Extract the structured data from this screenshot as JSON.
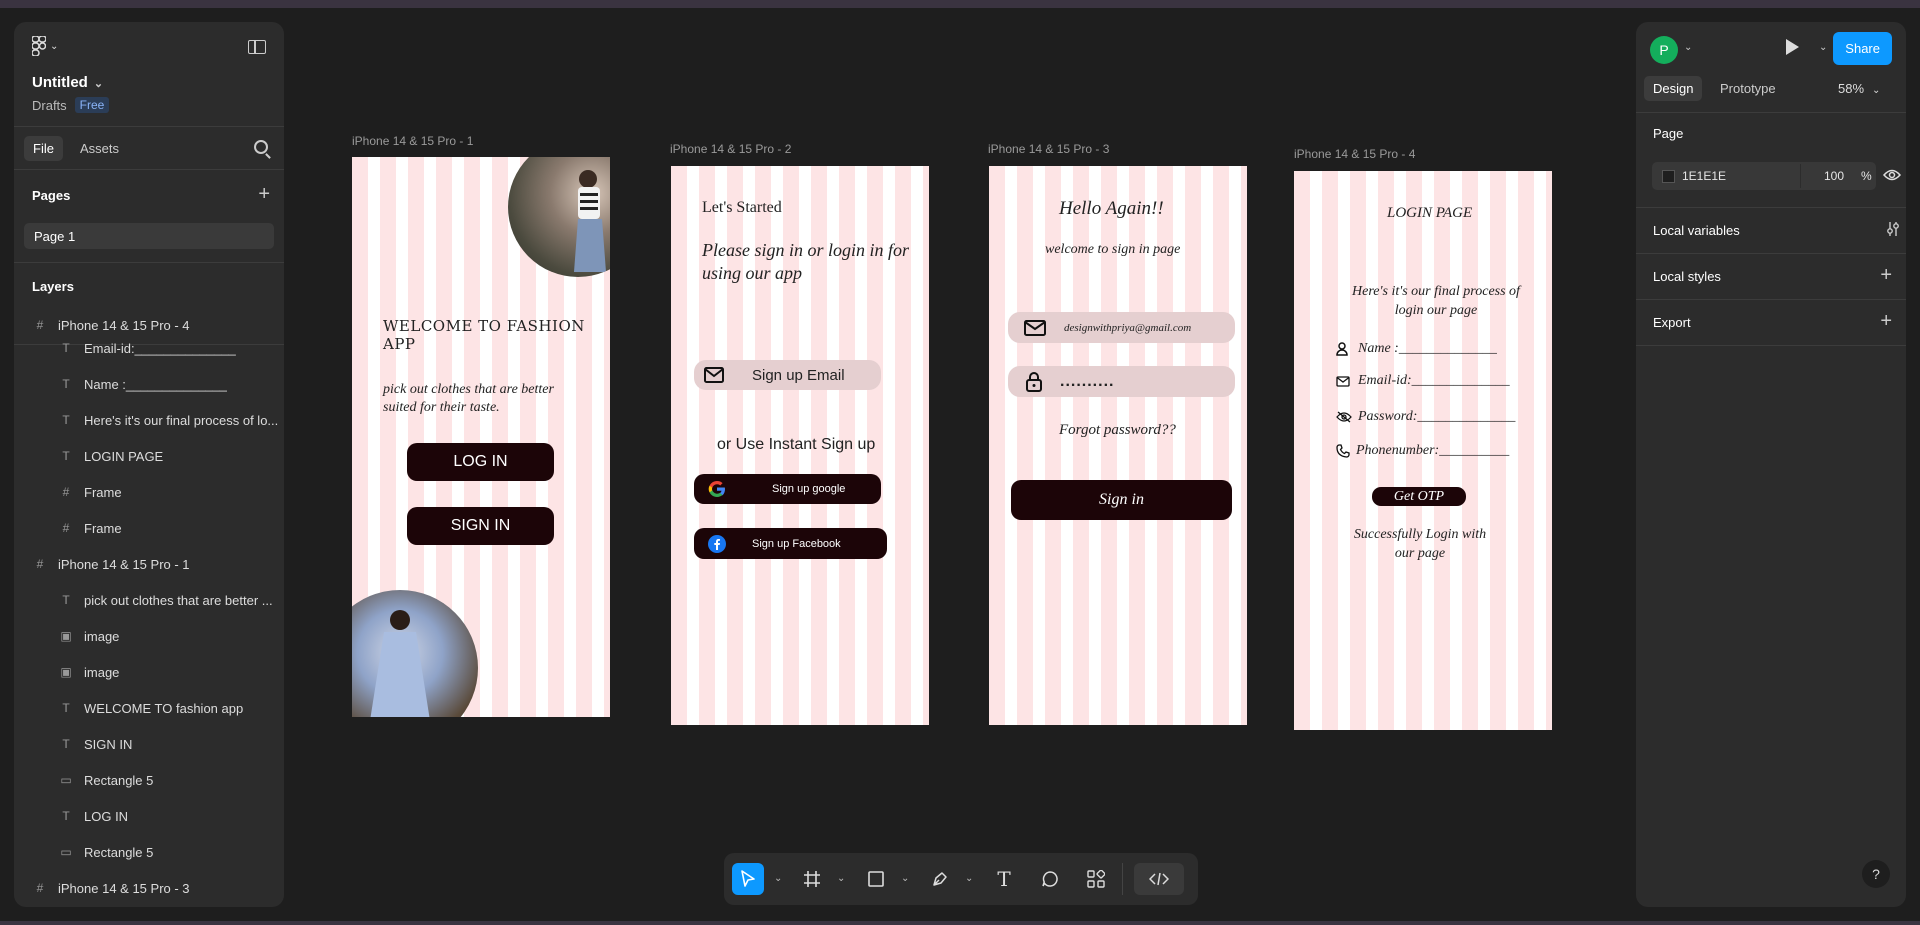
{
  "app": {
    "file_title": "Untitled",
    "location": "Drafts",
    "plan_badge": "Free"
  },
  "left_panel": {
    "tab_file": "File",
    "tab_assets": "Assets",
    "pages_heading": "Pages",
    "pages": [
      "Page 1"
    ],
    "layers_heading": "Layers",
    "layers": [
      {
        "type": "frame",
        "label": "iPhone 14 & 15 Pro - 4"
      },
      {
        "type": "text",
        "label": "Email-id:______________"
      },
      {
        "type": "text",
        "label": "Name :______________"
      },
      {
        "type": "text",
        "label": "Here's it's our final process of lo..."
      },
      {
        "type": "text",
        "label": "LOGIN PAGE"
      },
      {
        "type": "grid",
        "label": "Frame"
      },
      {
        "type": "grid",
        "label": "Frame"
      },
      {
        "type": "frame",
        "label": "iPhone 14 & 15 Pro - 1"
      },
      {
        "type": "text",
        "label": "pick out clothes that are better ..."
      },
      {
        "type": "image",
        "label": "image"
      },
      {
        "type": "image",
        "label": "image"
      },
      {
        "type": "text",
        "label": "WELCOME TO fashion app"
      },
      {
        "type": "text",
        "label": "SIGN IN"
      },
      {
        "type": "rect",
        "label": "Rectangle 5"
      },
      {
        "type": "text",
        "label": "LOG IN"
      },
      {
        "type": "rect",
        "label": "Rectangle 5"
      },
      {
        "type": "frame",
        "label": "iPhone 14 & 15 Pro - 3"
      }
    ]
  },
  "frames": {
    "f1": {
      "label": "iPhone 14 & 15 Pro - 1",
      "heading": "WELCOME TO FASHION APP",
      "tagline": "pick out clothes that are better suited for their taste.",
      "login_btn": "LOG IN",
      "signin_btn": "SIGN IN"
    },
    "f2": {
      "label": "iPhone 14 & 15 Pro - 2",
      "title": "Let's Started",
      "subtitle": "Please sign in or login in for using our app",
      "email_btn": "Sign up Email",
      "or_text": "or Use Instant Sign up",
      "google_btn": "Sign up google",
      "facebook_btn": "Sign up Facebook"
    },
    "f3": {
      "label": "iPhone 14 & 15 Pro - 3",
      "title": "Hello Again!!",
      "subtitle": "welcome to sign in page",
      "email": "designwithpriya@gmail.com",
      "password": "..........",
      "forgot": "Forgot password??",
      "signin_btn": "Sign in"
    },
    "f4": {
      "label": "iPhone 14 & 15 Pro - 4",
      "title": "LOGIN PAGE",
      "intro": "Here's it's our final process of login our page",
      "name_field": "Name :______________",
      "email_field": "Email-id:______________",
      "password_field": "Password:______________",
      "phone_field": "Phonenumber:__________",
      "otp_btn": "Get OTP",
      "success": "Successfully Login with our page"
    }
  },
  "right_panel": {
    "avatar_initial": "P",
    "share": "Share",
    "tab_design": "Design",
    "tab_prototype": "Prototype",
    "zoom": "58%",
    "page_heading": "Page",
    "page_color": "1E1E1E",
    "page_opacity": "100",
    "percent": "%",
    "local_variables": "Local variables",
    "local_styles": "Local styles",
    "export": "Export"
  },
  "colors": {
    "canvas": "#1e1e1e",
    "panel": "#2c2c2c",
    "accent": "#0d99ff",
    "stripe_pink": "#fde4e5",
    "button_dark": "#1c0508"
  }
}
